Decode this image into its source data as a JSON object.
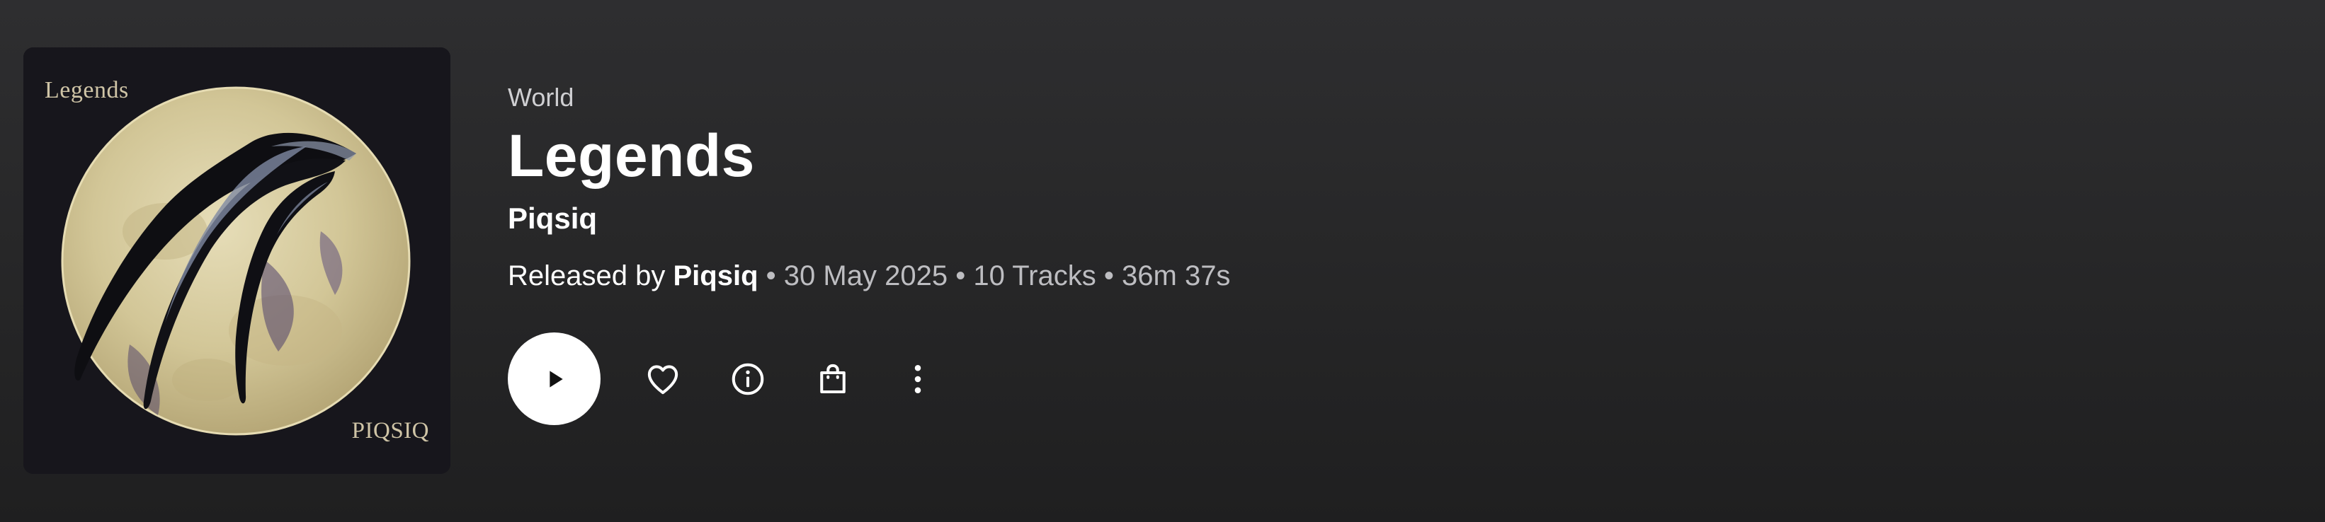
{
  "album": {
    "genre": "World",
    "title": "Legends",
    "artist": "Piqsiq",
    "cover": {
      "top_text": "Legends",
      "bottom_text": "PIQSIQ"
    },
    "meta": {
      "released_by_prefix": "Released by",
      "released_by_name": "Piqsiq",
      "separator": "•",
      "release_date": "30 May 2025",
      "tracks": "10 Tracks",
      "duration": "36m 37s"
    }
  },
  "actions": {
    "play_icon": "play-icon",
    "favorite_icon": "heart-icon",
    "info_icon": "info-icon",
    "buy_icon": "shopping-bag-icon",
    "more_icon": "more-vertical-icon"
  },
  "colors": {
    "background_top": "#2e2e30",
    "background_bottom": "#1f1f20",
    "text_primary": "#ffffff",
    "text_secondary": "#bdbdc1",
    "play_button": "#ffffff"
  }
}
